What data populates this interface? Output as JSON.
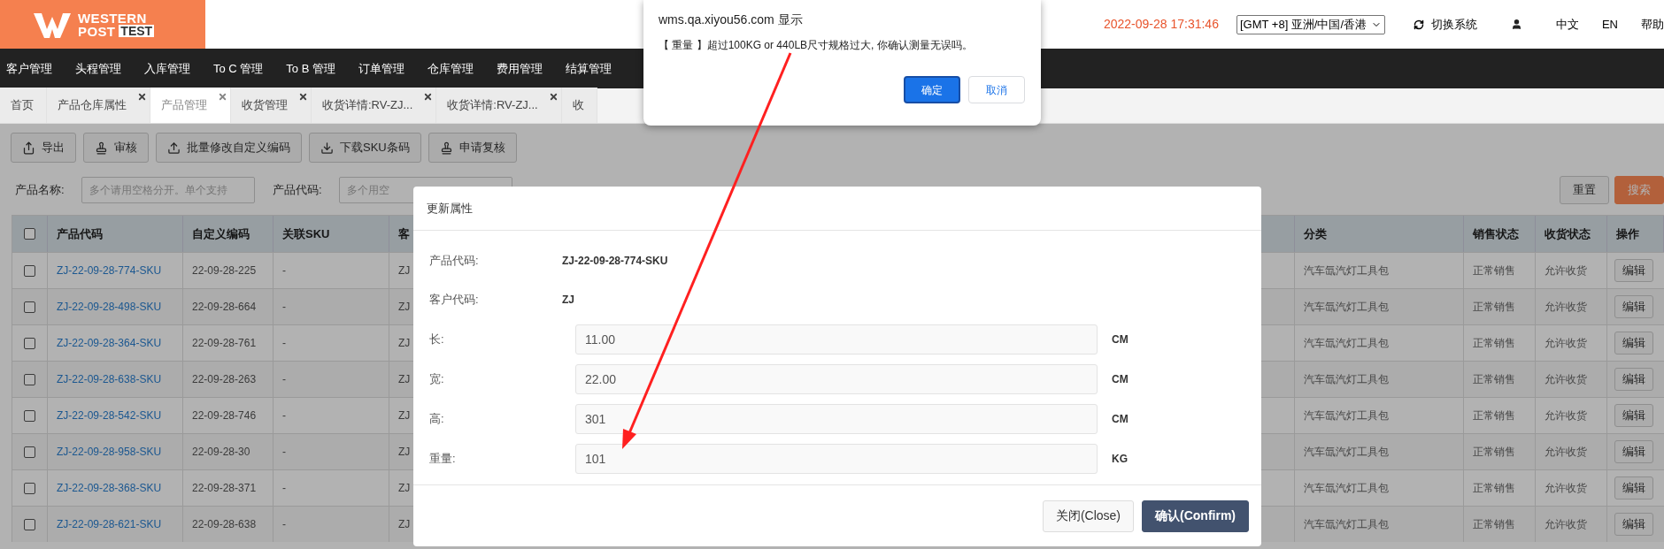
{
  "header": {
    "logo": {
      "line1": "WESTERN",
      "line2": "POST",
      "line2_tag": "TEST"
    },
    "datetime": "2022-09-28 17:31:46",
    "timezone": "[GMT +8] 亚洲/中国/香港",
    "switch_system": "切换系统",
    "languages": [
      {
        "label": "中文"
      },
      {
        "label": "EN"
      }
    ],
    "help": "帮助"
  },
  "nav": {
    "items": [
      {
        "label": "客户管理"
      },
      {
        "label": "头程管理"
      },
      {
        "label": "入库管理"
      },
      {
        "label": "To C 管理"
      },
      {
        "label": "To B 管理"
      },
      {
        "label": "订单管理"
      },
      {
        "label": "仓库管理"
      },
      {
        "label": "费用管理"
      },
      {
        "label": "结算管理"
      }
    ]
  },
  "tabs": [
    {
      "label": "首页",
      "selected": false,
      "closable": false
    },
    {
      "label": "产品仓库属性",
      "selected": false,
      "closable": true
    },
    {
      "label": "产品管理",
      "selected": true,
      "closable": true
    },
    {
      "label": "收货管理",
      "selected": false,
      "closable": true
    },
    {
      "label": "收货详情:RV-ZJ...",
      "selected": false,
      "closable": true
    },
    {
      "label": "收货详情:RV-ZJ...",
      "selected": false,
      "closable": true
    },
    {
      "label": "收",
      "selected": false,
      "closable": false
    }
  ],
  "toolbar": {
    "buttons": [
      {
        "label": "导出"
      },
      {
        "label": "审核"
      },
      {
        "label": "批量修改自定义编码"
      },
      {
        "label": "下载SKU条码"
      },
      {
        "label": "申请复核"
      }
    ]
  },
  "search": {
    "fields": [
      {
        "label": "产品名称:",
        "placeholder": "多个请用空格分开。单个支持"
      },
      {
        "label": "产品代码:",
        "placeholder": "多个用空"
      }
    ],
    "buttons": [
      {
        "label": "重置",
        "kind": "default"
      },
      {
        "label": "搜索",
        "kind": "primary"
      }
    ]
  },
  "table": {
    "select_all": false,
    "columns": [
      {
        "label": "产品代码"
      },
      {
        "label": "自定义编码"
      },
      {
        "label": "关联SKU"
      },
      {
        "label": "客"
      },
      {
        "label": "分类"
      },
      {
        "label": "销售状态"
      },
      {
        "label": "收货状态"
      },
      {
        "label": "操作"
      }
    ],
    "rows": [
      {
        "checked": false,
        "code": "ZJ-22-09-28-774-SKU",
        "custom_code": "22-09-28-225",
        "linked_sku": "-",
        "customer": "ZJ",
        "category": "汽车氙汽灯工具包",
        "sale_status": "正常销售",
        "receive_status": "允许收货",
        "action": "编辑"
      },
      {
        "checked": false,
        "code": "ZJ-22-09-28-498-SKU",
        "custom_code": "22-09-28-664",
        "linked_sku": "-",
        "customer": "ZJ",
        "category": "汽车氙汽灯工具包",
        "sale_status": "正常销售",
        "receive_status": "允许收货",
        "action": "编辑"
      },
      {
        "checked": false,
        "code": "ZJ-22-09-28-364-SKU",
        "custom_code": "22-09-28-761",
        "linked_sku": "-",
        "customer": "ZJ",
        "category": "汽车氙汽灯工具包",
        "sale_status": "正常销售",
        "receive_status": "允许收货",
        "action": "编辑"
      },
      {
        "checked": false,
        "code": "ZJ-22-09-28-638-SKU",
        "custom_code": "22-09-28-263",
        "linked_sku": "-",
        "customer": "ZJ",
        "category": "汽车氙汽灯工具包",
        "sale_status": "正常销售",
        "receive_status": "允许收货",
        "action": "编辑"
      },
      {
        "checked": false,
        "code": "ZJ-22-09-28-542-SKU",
        "custom_code": "22-09-28-746",
        "linked_sku": "-",
        "customer": "ZJ",
        "category": "汽车氙汽灯工具包",
        "sale_status": "正常销售",
        "receive_status": "允许收货",
        "action": "编辑"
      },
      {
        "checked": false,
        "code": "ZJ-22-09-28-958-SKU",
        "custom_code": "22-09-28-30",
        "linked_sku": "-",
        "customer": "ZJ",
        "category": "汽车氙汽灯工具包",
        "sale_status": "正常销售",
        "receive_status": "允许收货",
        "action": "编辑"
      },
      {
        "checked": false,
        "code": "ZJ-22-09-28-368-SKU",
        "custom_code": "22-09-28-371",
        "linked_sku": "-",
        "customer": "ZJ",
        "category": "汽车氙汽灯工具包",
        "sale_status": "正常销售",
        "receive_status": "允许收货",
        "action": "编辑"
      },
      {
        "checked": false,
        "code": "ZJ-22-09-28-621-SKU",
        "custom_code": "22-09-28-638",
        "linked_sku": "-",
        "customer": "ZJ",
        "category": "汽车氙汽灯工具包",
        "sale_status": "正常销售",
        "receive_status": "允许收货",
        "action": "编辑"
      }
    ]
  },
  "dialog": {
    "title": "更新属性",
    "info": [
      {
        "label": "产品代码:",
        "value": "ZJ-22-09-28-774-SKU"
      },
      {
        "label": "客户代码:",
        "value": "ZJ"
      }
    ],
    "fields": [
      {
        "label": "长:",
        "value": "11.00",
        "unit": "CM"
      },
      {
        "label": "宽:",
        "value": "22.00",
        "unit": "CM"
      },
      {
        "label": "高:",
        "value": "301",
        "unit": "CM"
      },
      {
        "label": "重量:",
        "value": "101",
        "unit": "KG"
      }
    ],
    "buttons": [
      {
        "label": "关闭(Close)",
        "kind": "default"
      },
      {
        "label": "确认(Confirm)",
        "kind": "primary"
      }
    ]
  },
  "alert": {
    "title": "wms.qa.xiyou56.com 显示",
    "message": "【 重量 】超过100KG or 440LB尺寸规格过大, 你确认测量无误吗。",
    "buttons": [
      {
        "label": "确定",
        "kind": "primary"
      },
      {
        "label": "取消",
        "kind": "default"
      }
    ]
  }
}
